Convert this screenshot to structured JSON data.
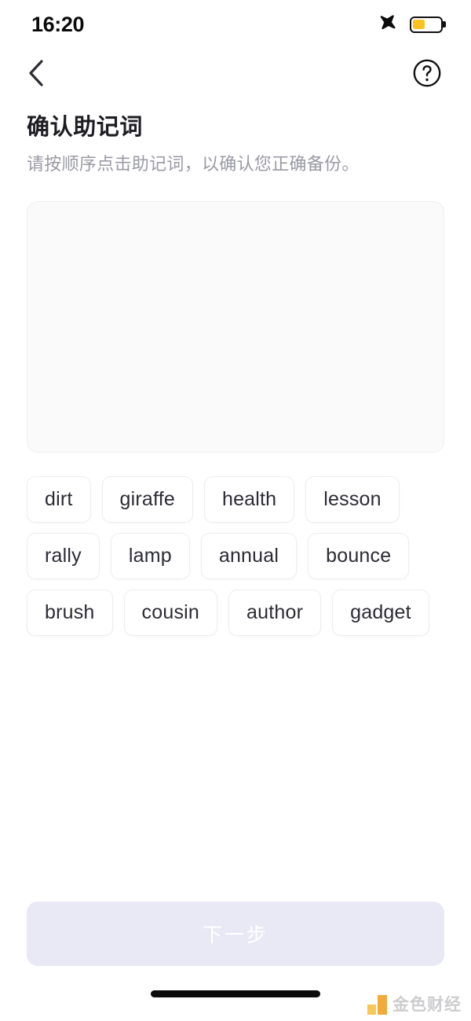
{
  "status_bar": {
    "time": "16:20",
    "airplane_icon": "airplane-mode-icon",
    "battery_icon": "battery-icon",
    "battery_level_percent": 45,
    "battery_fill_color": "#fcc31f"
  },
  "nav": {
    "back_icon": "chevron-left-icon",
    "help_icon": "help-circle-icon"
  },
  "header": {
    "title": "确认助记词",
    "subtitle": "请按顺序点击助记词，以确认您正确备份。"
  },
  "selected_panel": {
    "name": "selected-mnemonic-area",
    "selected_words": []
  },
  "word_bank": {
    "words": [
      "dirt",
      "giraffe",
      "health",
      "lesson",
      "rally",
      "lamp",
      "annual",
      "bounce",
      "brush",
      "cousin",
      "author",
      "gadget"
    ]
  },
  "footer": {
    "primary_button_label": "下一步",
    "primary_button_enabled": false,
    "primary_button_bg": "#e9e9f6",
    "primary_button_text_color": "#ffffff"
  },
  "watermark": {
    "text": "金色财经",
    "mark_color": "#f0a42a"
  },
  "home_indicator": {
    "name": "home-indicator"
  }
}
